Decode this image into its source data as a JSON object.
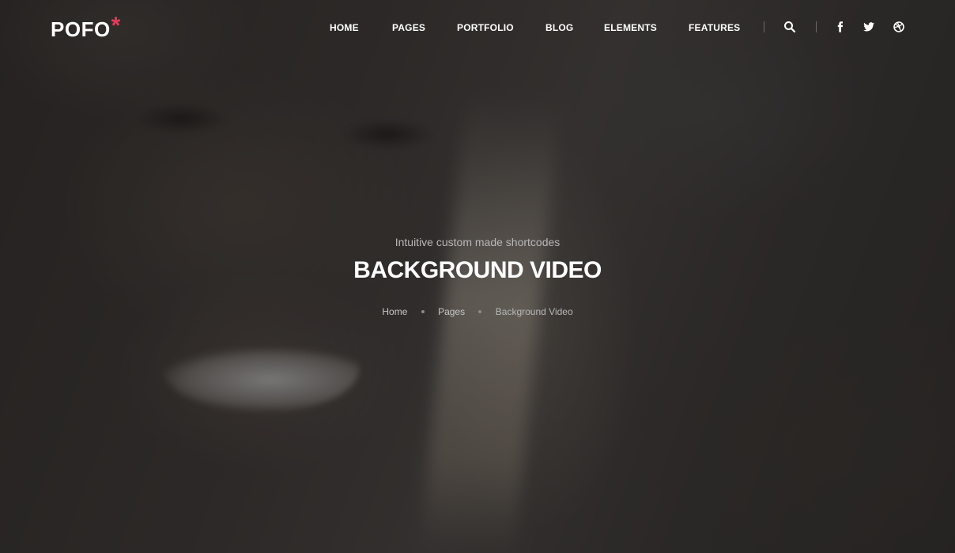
{
  "brand": {
    "name": "POFO",
    "mark": "*",
    "accent_color": "#e63a5a"
  },
  "nav": {
    "items": [
      {
        "label": "HOME"
      },
      {
        "label": "PAGES"
      },
      {
        "label": "PORTFOLIO"
      },
      {
        "label": "BLOG"
      },
      {
        "label": "ELEMENTS"
      },
      {
        "label": "FEATURES"
      }
    ],
    "search_icon": "search-icon",
    "social": [
      "facebook-icon",
      "twitter-icon",
      "dribbble-icon"
    ]
  },
  "hero": {
    "subtitle": "Intuitive custom made shortcodes",
    "title": "BACKGROUND VIDEO",
    "breadcrumb": [
      "Home",
      "Pages",
      "Background Video"
    ]
  }
}
